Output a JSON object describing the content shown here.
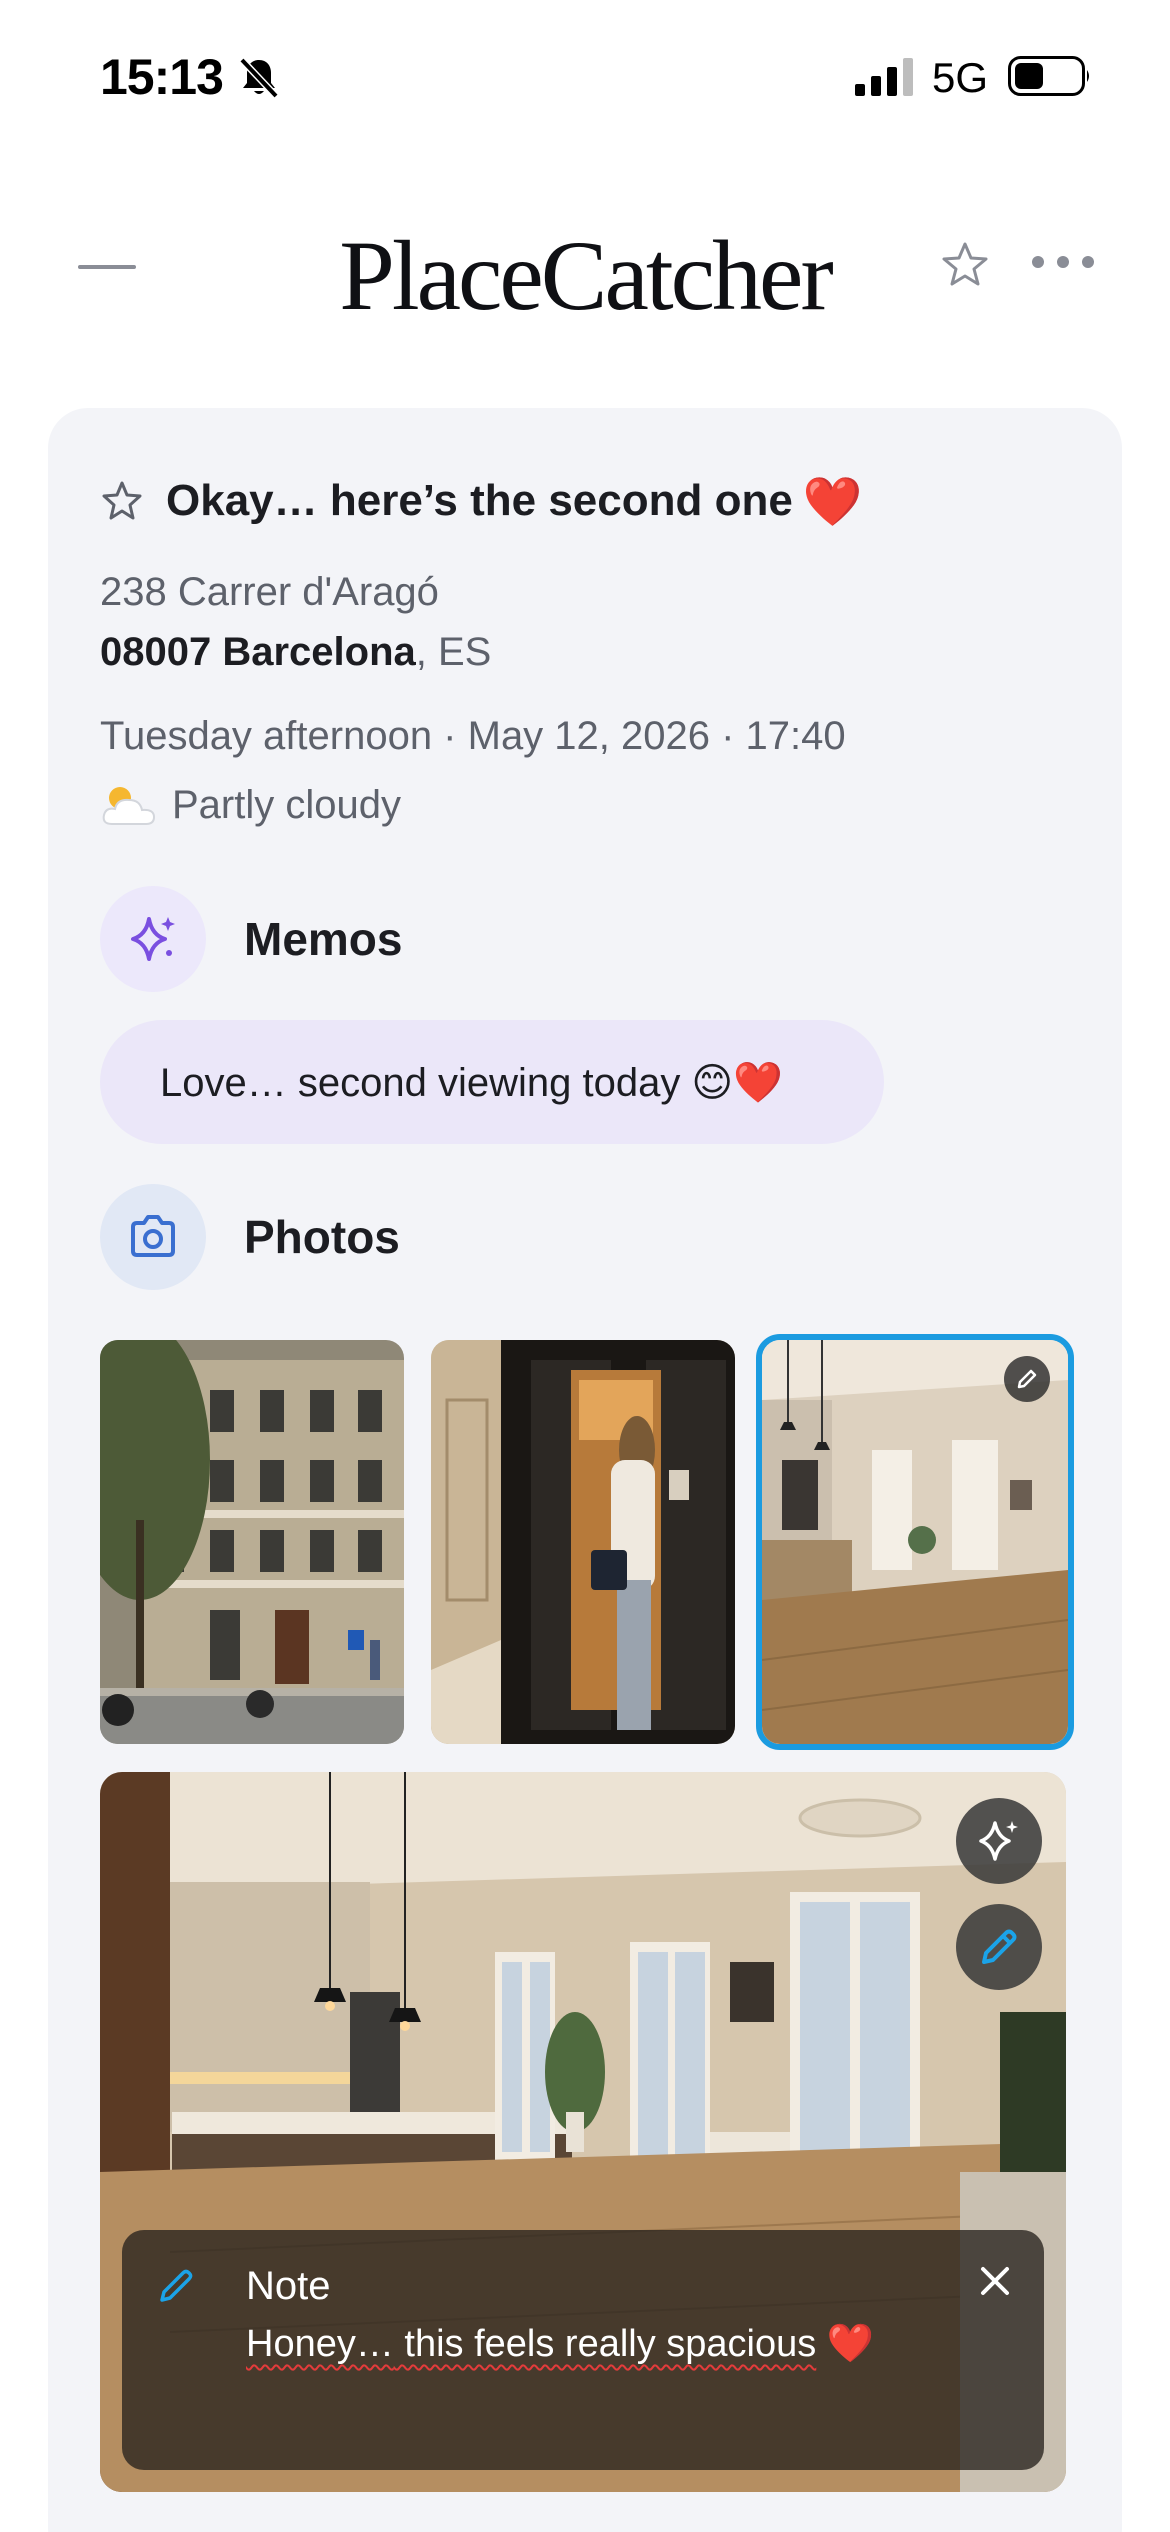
{
  "status_bar": {
    "time": "15:13",
    "network": "5G",
    "icons": [
      "bell-slash-icon",
      "signal-icon",
      "battery-icon"
    ]
  },
  "header": {
    "app_title": "PlaceCatcher",
    "icons": [
      "menu-icon",
      "star-outline-icon",
      "more-dots-icon"
    ]
  },
  "entry": {
    "title": "Okay… here’s the second one",
    "title_emoji": "❤️",
    "address_line1": "238 Carrer d'Aragó",
    "postcode_city": "08007 Barcelona",
    "country": ", ES",
    "datetime": "Tuesday afternoon · May 12, 2026 · 17:40",
    "weather": "Partly cloudy"
  },
  "memos": {
    "label": "Memos",
    "items": [
      {
        "text": "Love… second viewing today 😊❤️"
      }
    ]
  },
  "photos": {
    "label": "Photos",
    "thumbnails": [
      {
        "name": "building-facade"
      },
      {
        "name": "entrance-door"
      },
      {
        "name": "interior-kitchen",
        "selected": true
      }
    ]
  },
  "note": {
    "title": "Note",
    "text_misspelled": "Honey…",
    "text_rest": " this feels really spacious",
    "emoji": "❤️"
  },
  "colors": {
    "accent_blue": "#1b9be0",
    "memo_purple": "#7a4fe0",
    "photo_blue": "#3a6fd0",
    "heart_red": "#e0202c"
  }
}
